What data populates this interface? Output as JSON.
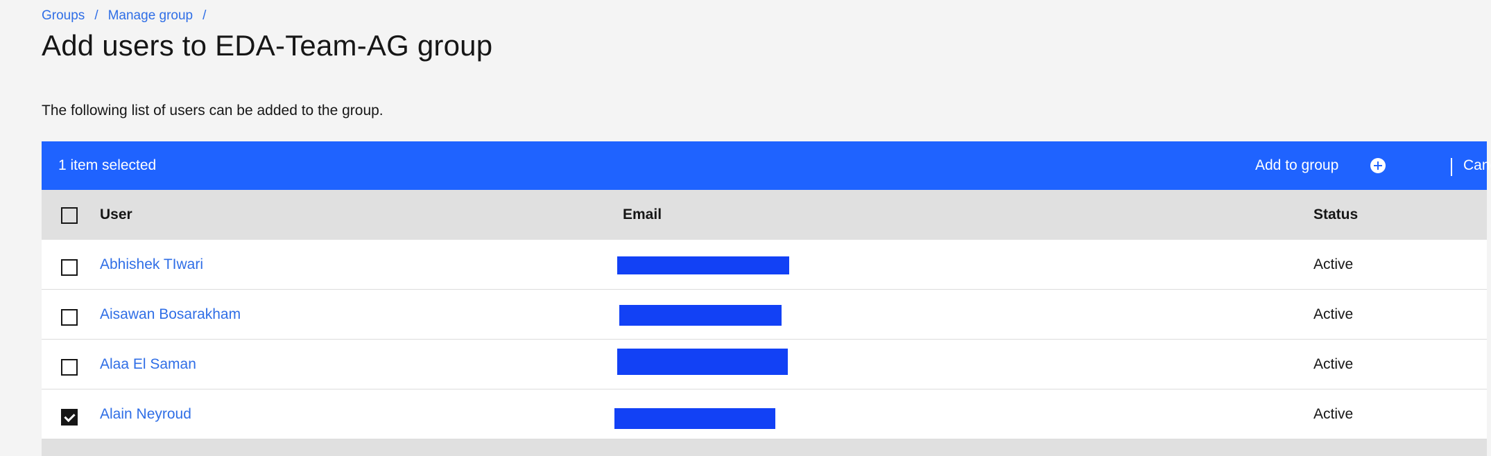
{
  "breadcrumb": {
    "items": [
      "Groups",
      "Manage group"
    ],
    "separator": "/"
  },
  "page": {
    "title": "Add users to EDA-Team-AG group",
    "description": "The following list of users can be added to the group."
  },
  "batch_actions": {
    "selected_text": "1 item selected",
    "add_label": "Add to group",
    "cancel_label": "Cancel",
    "bar_color": "#1f63ff"
  },
  "table": {
    "headers": {
      "user": "User",
      "email": "Email",
      "status": "Status"
    },
    "rows": [
      {
        "user": "Abhishek TIwari",
        "email": "",
        "status": "Active",
        "checked": false
      },
      {
        "user": "Aisawan Bosarakham",
        "email": "",
        "status": "Active",
        "checked": false
      },
      {
        "user": "Alaa El Saman",
        "email": "",
        "status": "Active",
        "checked": false
      },
      {
        "user": "Alain Neyroud",
        "email": "",
        "status": "Active",
        "checked": true
      }
    ]
  },
  "colors": {
    "link": "#2f6ee6",
    "redaction": "#1241f5"
  }
}
